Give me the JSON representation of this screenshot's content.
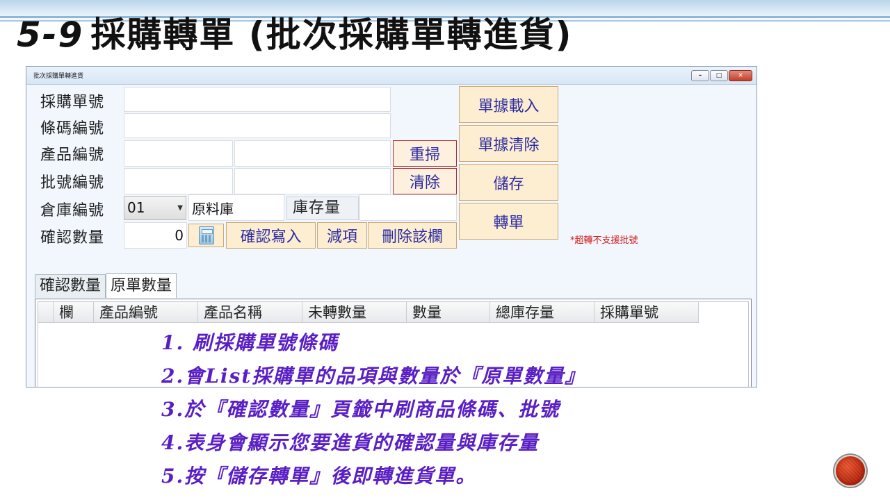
{
  "slide": {
    "number": "5-9",
    "title": "採購轉單 (批次採購單轉進貨)"
  },
  "window": {
    "title": "批次採購單轉進貨",
    "controls": {
      "minimize": "–",
      "maximize": "□",
      "close": "✕"
    }
  },
  "form": {
    "labels": {
      "po_no": "採購單號",
      "barcode": "條碼編號",
      "product_no": "產品編號",
      "batch_no": "批號編號",
      "warehouse": "倉庫編號",
      "confirm_qty": "確認數量",
      "stock_qty": "庫存量"
    },
    "values": {
      "po_no": "",
      "barcode": "",
      "product_no": "",
      "product_name": "",
      "batch_no": "",
      "batch_extra": "",
      "warehouse_code": "01",
      "warehouse_name": "原料庫",
      "stock_qty": "",
      "confirm_qty": "0"
    },
    "buttons": {
      "rescan": "重掃",
      "clear": "清除",
      "load_doc": "單據載入",
      "clear_doc": "單據清除",
      "save": "儲存",
      "transfer": "轉單",
      "confirm_write": "確認寫入",
      "subtract": "減項",
      "delete_row": "刪除該欄"
    },
    "note": "*超轉不支援批號"
  },
  "tabs": [
    {
      "label": "確認數量",
      "active": false
    },
    {
      "label": "原單數量",
      "active": true
    }
  ],
  "grid": {
    "columns": [
      "",
      "欄",
      "產品編號",
      "產品名稱",
      "未轉數量",
      "數量",
      "總庫存量",
      "採購單號"
    ]
  },
  "notes": [
    "1. 刷採購單號條碼",
    "2.會List採購單的品項與數量於『原單數量』",
    "3.於『確認數量』頁籤中刷商品條碼、批號",
    "4.表身會顯示您要進貨的確認量與庫存量",
    "5.按『儲存轉單』後即轉進貨單。"
  ],
  "colors": {
    "accent_text": "#2b2ba0",
    "note_text": "#5a1fc4",
    "warning": "#d21b1b",
    "button_bg": "#fdeed2"
  }
}
